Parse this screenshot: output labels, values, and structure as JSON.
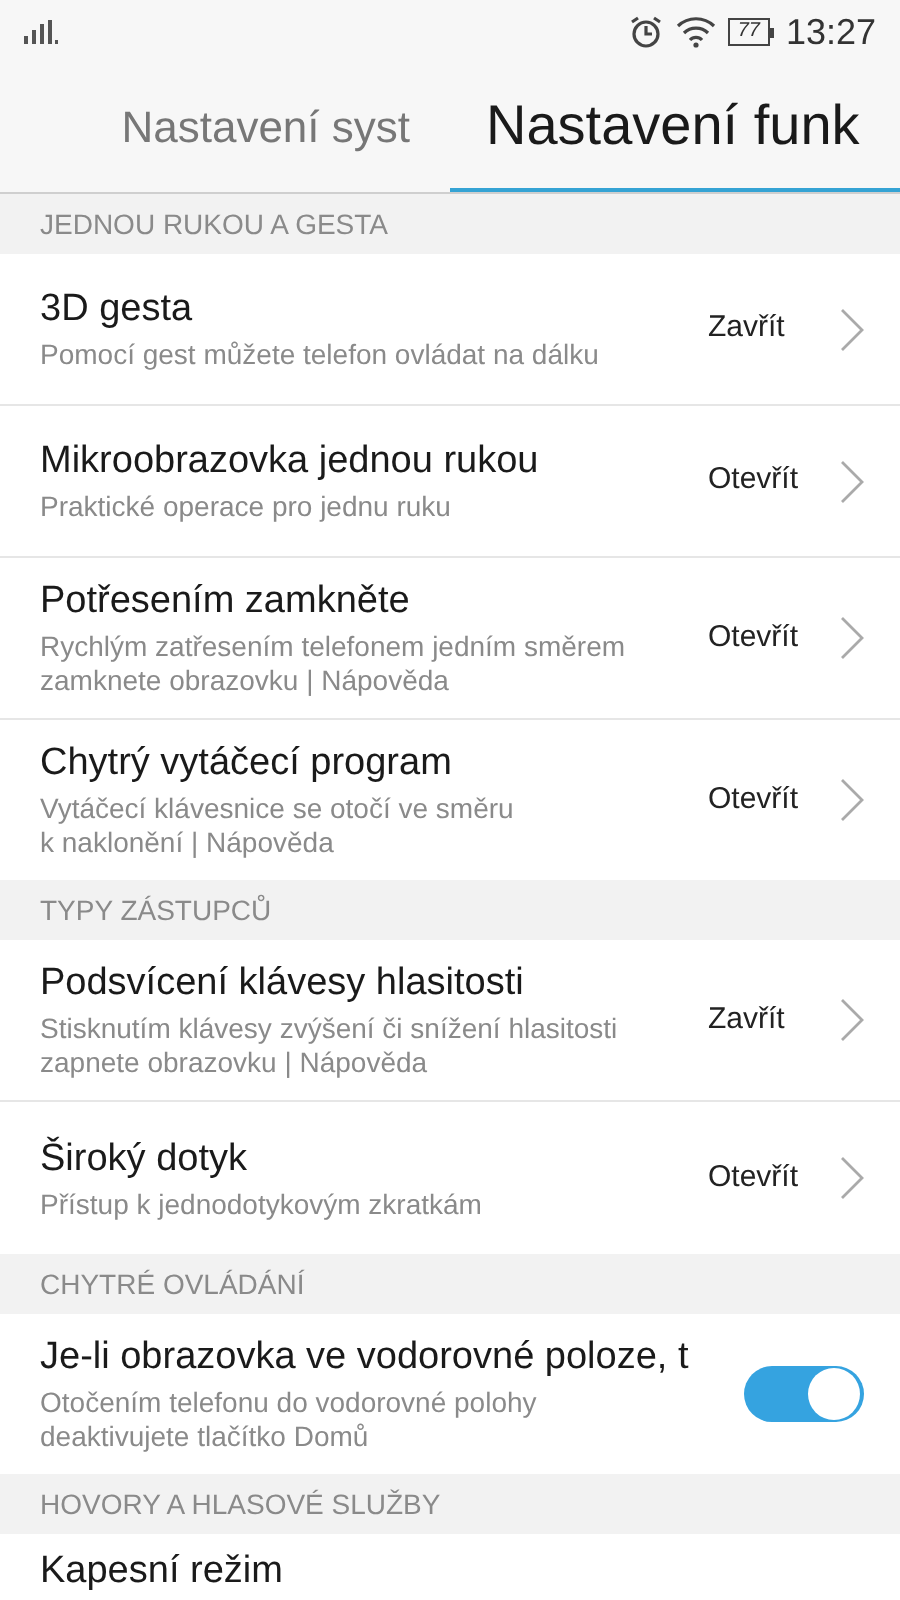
{
  "status_bar": {
    "time": "13:27",
    "battery": "77"
  },
  "tabs": [
    {
      "label": "Nastavení syst",
      "selected": false
    },
    {
      "label": "Nastavení funk",
      "selected": true
    }
  ],
  "sections": [
    {
      "header": "JEDNOU RUKOU A GESTA",
      "items": [
        {
          "kind": "nav",
          "title": "3D gesta",
          "subtitle": "Pomocí gest můžete telefon ovládat na dálku",
          "action": "Zavřít"
        },
        {
          "kind": "nav",
          "title": "Mikroobrazovka jednou rukou",
          "subtitle": "Praktické operace pro jednu ruku",
          "action": "Otevřít"
        },
        {
          "kind": "nav",
          "title": "Potřesením zamkněte",
          "subtitle": "Rychlým zatřesením telefonem jedním směrem zamknete obrazovku | Nápověda",
          "action": "Otevřít"
        },
        {
          "kind": "nav",
          "title": "Chytrý vytáčecí program",
          "subtitle": "Vytáčecí klávesnice se otočí ve směru\nk naklonění | Nápověda",
          "action": "Otevřít"
        }
      ]
    },
    {
      "header": "TYPY ZÁSTUPCŮ",
      "items": [
        {
          "kind": "nav",
          "title": "Podsvícení klávesy hlasitosti",
          "subtitle": "Stisknutím klávesy zvýšení či snížení hlasitosti zapnete obrazovku | Nápověda",
          "action": "Zavřít"
        },
        {
          "kind": "nav",
          "title": "Široký dotyk",
          "subtitle": "Přístup k jednodotykovým zkratkám",
          "action": "Otevřít"
        }
      ]
    },
    {
      "header": "CHYTRÉ OVLÁDÁNÍ",
      "items": [
        {
          "kind": "switch",
          "title": "Je-li obrazovka ve vodorovné poloze, t",
          "subtitle": "Otočením telefonu do vodorovné polohy\ndeaktivujete tlačítko Domů",
          "on": true
        }
      ]
    },
    {
      "header": "HOVORY A HLASOVÉ SLUŽBY",
      "items": [
        {
          "kind": "plain",
          "title": "Kapesní režim"
        }
      ]
    }
  ]
}
